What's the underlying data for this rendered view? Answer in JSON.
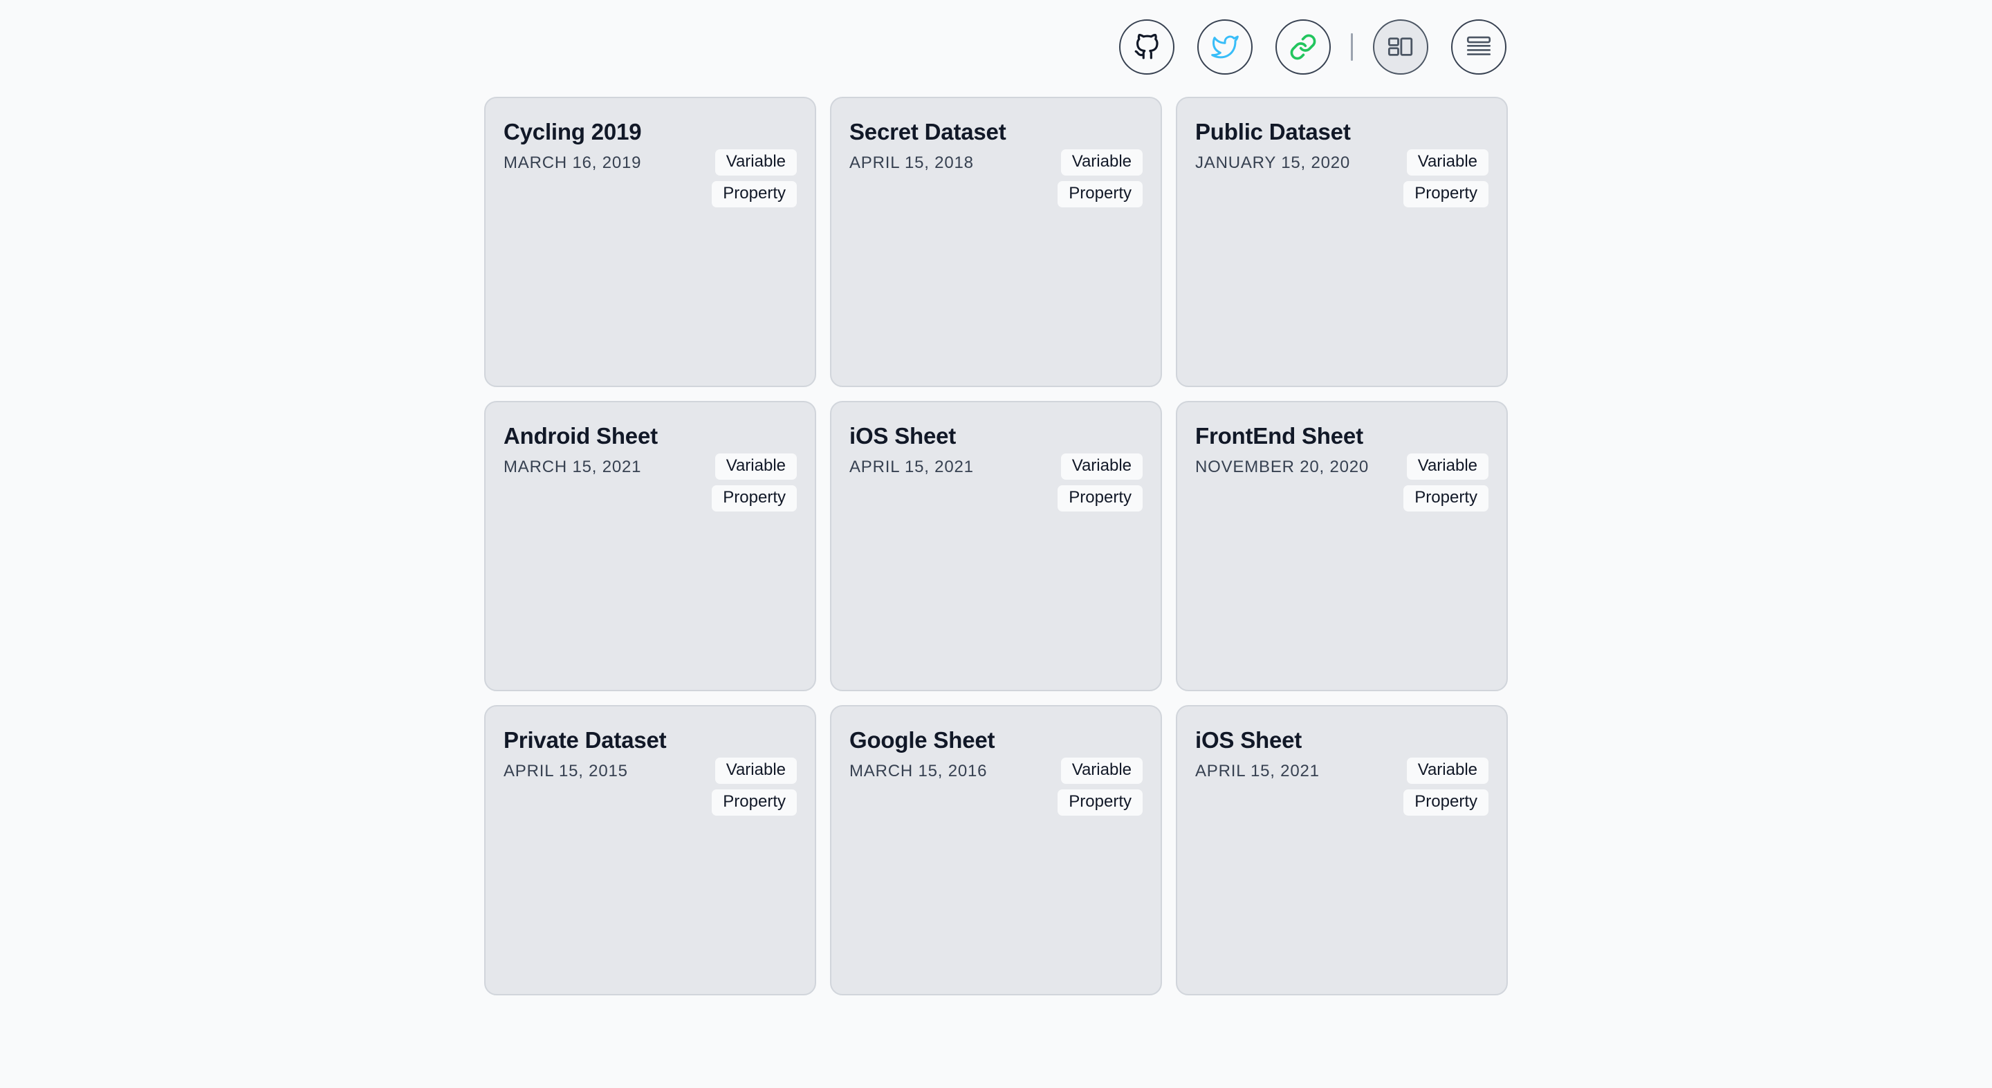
{
  "toolbar": {
    "buttons": [
      {
        "icon": "github-icon"
      },
      {
        "icon": "twitter-icon",
        "color": "#38bdf8"
      },
      {
        "icon": "link-icon",
        "color": "#22c55e"
      },
      {
        "icon": "grid-view-icon",
        "active": true
      },
      {
        "icon": "list-view-icon"
      }
    ]
  },
  "cards": [
    {
      "title": "Cycling 2019",
      "date": "MARCH 16, 2019",
      "tags": [
        "Variable",
        "Property"
      ]
    },
    {
      "title": "Secret Dataset",
      "date": "APRIL 15, 2018",
      "tags": [
        "Variable",
        "Property"
      ]
    },
    {
      "title": "Public Dataset",
      "date": "JANUARY 15, 2020",
      "tags": [
        "Variable",
        "Property"
      ]
    },
    {
      "title": "Android Sheet",
      "date": "MARCH 15, 2021",
      "tags": [
        "Variable",
        "Property"
      ]
    },
    {
      "title": "iOS Sheet",
      "date": "APRIL 15, 2021",
      "tags": [
        "Variable",
        "Property"
      ]
    },
    {
      "title": "FrontEnd Sheet",
      "date": "NOVEMBER 20, 2020",
      "tags": [
        "Variable",
        "Property"
      ]
    },
    {
      "title": "Private Dataset",
      "date": "APRIL 15, 2015",
      "tags": [
        "Variable",
        "Property"
      ]
    },
    {
      "title": "Google Sheet",
      "date": "MARCH 15, 2016",
      "tags": [
        "Variable",
        "Property"
      ]
    },
    {
      "title": "iOS Sheet",
      "date": "APRIL 15, 2021",
      "tags": [
        "Variable",
        "Property"
      ]
    }
  ]
}
